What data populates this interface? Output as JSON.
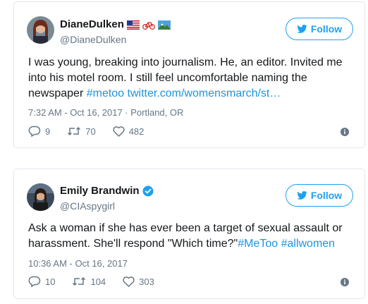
{
  "colors": {
    "accent": "#1da1f2",
    "link": "#1b95e0",
    "muted": "#657786",
    "verified": "#1da1f2"
  },
  "tweets": [
    {
      "display_name": "DianeDulken",
      "name_emojis": [
        "us-flag-icon",
        "bicycle-icon",
        "landscape-icon"
      ],
      "handle": "@DianeDulken",
      "follow_label": "Follow",
      "text_plain": "I was young, breaking into journalism. He, an editor. Invited me into his motel room. I still feel uncomfortable naming the newspaper ",
      "hashtag": "#metoo",
      "link": " twitter.com/womensmarch/st…",
      "timestamp": "7:32 AM - Oct 16, 2017 · Portland, OR",
      "replies": "9",
      "retweets": "70",
      "likes": "482"
    },
    {
      "display_name": "Emily Brandwin",
      "verified": true,
      "handle": "@CIAspygirl",
      "follow_label": "Follow",
      "text_plain": "Ask a woman if she has ever been a target of sexual assault or harassment. She'll respond \"Which time?\"",
      "hashtag": "#MeToo",
      "hashtag2": " #allwomen",
      "timestamp": "10:36 AM - Oct 16, 2017",
      "replies": "10",
      "retweets": "104",
      "likes": "303"
    }
  ]
}
